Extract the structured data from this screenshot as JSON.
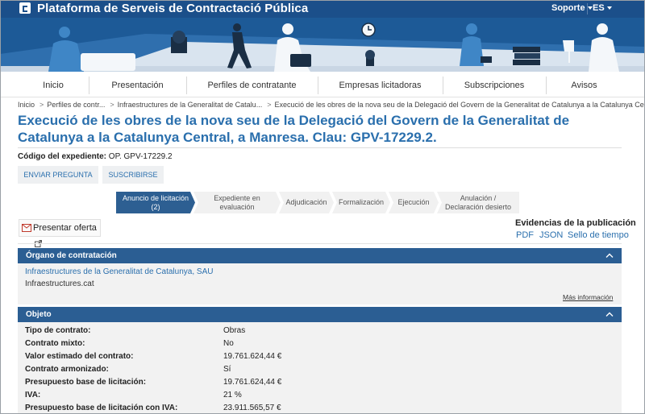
{
  "header": {
    "site_title": "Plataforma de Serveis de Contractació Pública",
    "support_label": "Soporte",
    "lang_label": "ES"
  },
  "nav": {
    "items": [
      {
        "label": "Inicio"
      },
      {
        "label": "Presentación"
      },
      {
        "label": "Perfiles de contratante"
      },
      {
        "label": "Empresas licitadoras"
      },
      {
        "label": "Subscripciones"
      },
      {
        "label": "Avisos"
      }
    ]
  },
  "breadcrumb": [
    {
      "label": "Inicio"
    },
    {
      "label": "Perfiles de contr..."
    },
    {
      "label": "Infraestructures de la Generalitat de Catalu..."
    },
    {
      "label": "Execució de les obres de la nova seu de la Delegació del Govern de la Generalitat de Catalunya a la Catalunya Central, a ..."
    }
  ],
  "page": {
    "title": "Execució de les obres de la nova seu de la Delegació del Govern de la Generalitat de Catalunya a la Catalunya Central, a Manresa. Clau: GPV-17229.2.",
    "code_label": "Código del expediente:",
    "code_value": "OP. GPV-17229.2"
  },
  "actions": {
    "ask_label": "ENVIAR PREGUNTA",
    "subscribe_label": "SUSCRIBIRSE",
    "submit_offer_label": "Presentar oferta"
  },
  "steps": [
    {
      "label": "Anuncio de licitación (2)",
      "active": true
    },
    {
      "label": "Expediente en evaluación",
      "active": false
    },
    {
      "label": "Adjudicación",
      "active": false
    },
    {
      "label": "Formalización",
      "active": false
    },
    {
      "label": "Ejecución",
      "active": false
    },
    {
      "label": "Anulación / Declaración desierto",
      "active": false
    }
  ],
  "evidence": {
    "title": "Evidencias de la publicación",
    "links": [
      {
        "label": "PDF"
      },
      {
        "label": "JSON"
      },
      {
        "label": "Sello de tiempo"
      }
    ]
  },
  "organ": {
    "heading": "Órgano de contratación",
    "name": "Infraestructures de la Generalitat de Catalunya, SAU",
    "site": "Infraestructures.cat",
    "more_label": "Más información"
  },
  "objeto": {
    "heading": "Objeto",
    "rows": [
      {
        "label": "Tipo de contrato:",
        "value": "Obras"
      },
      {
        "label": "Contrato mixto:",
        "value": "No"
      },
      {
        "label": "Valor estimado del contrato:",
        "value": "19.761.624,44 €"
      },
      {
        "label": "Contrato armonizado:",
        "value": "Sí"
      },
      {
        "label": "Presupuesto base de licitación:",
        "value": "19.761.624,44 €"
      },
      {
        "label": "IVA:",
        "value": "21 %"
      },
      {
        "label": "Presupuesto base de licitación con IVA:",
        "value": "23.911.565,57 €"
      }
    ]
  },
  "colors": {
    "header_bg": "#1b4f8a",
    "banner_bg": "#1d5a97",
    "link": "#2a6fad",
    "section_bg": "#2b5e93",
    "step_active": "#2d5f92",
    "step_inactive": "#f1f1f1"
  }
}
